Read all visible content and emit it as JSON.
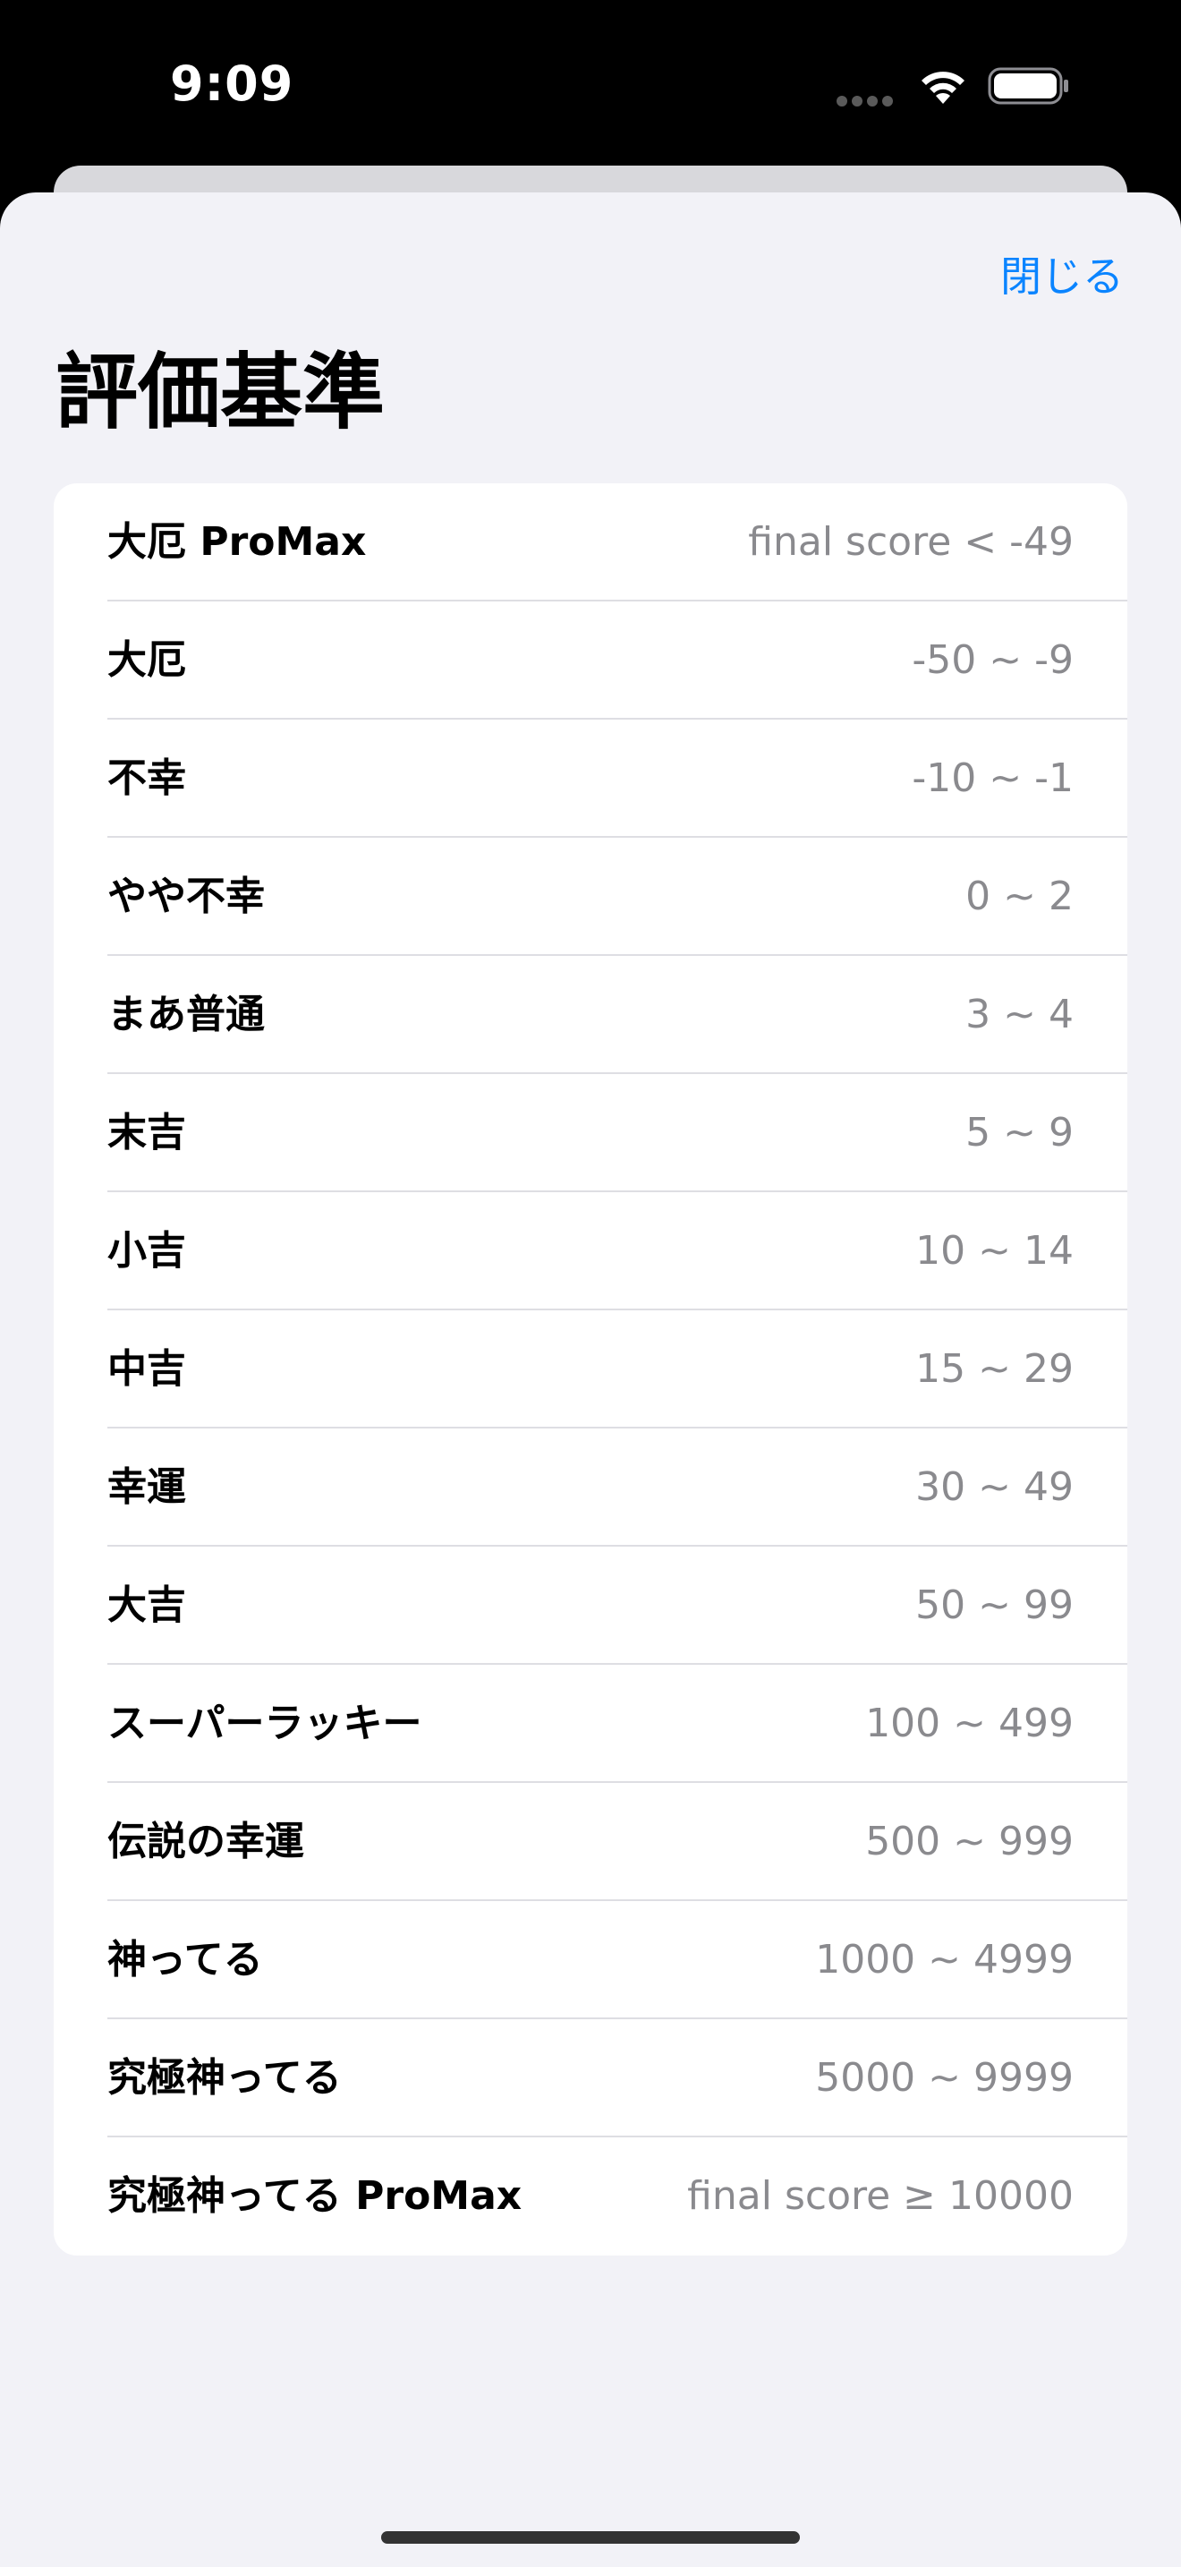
{
  "status_bar": {
    "time": "9:09",
    "wifi_icon": "wifi-icon",
    "battery_icon": "battery-icon",
    "signal_icon": "cellular-dots-icon"
  },
  "header": {
    "close_label": "閉じる",
    "title": "評価基準"
  },
  "colors": {
    "accent": "#0a84ff",
    "sheet_background": "#f2f2f7",
    "range_text": "#8a8a8e"
  },
  "criteria": [
    {
      "label": "大厄 ProMax",
      "range": "final score < -49"
    },
    {
      "label": "大厄",
      "range": "-50 ~ -9"
    },
    {
      "label": "不幸",
      "range": "-10 ~ -1"
    },
    {
      "label": "やや不幸",
      "range": "0 ~ 2"
    },
    {
      "label": "まあ普通",
      "range": "3 ~ 4"
    },
    {
      "label": "末吉",
      "range": "5 ~ 9"
    },
    {
      "label": "小吉",
      "range": "10 ~ 14"
    },
    {
      "label": "中吉",
      "range": "15 ~ 29"
    },
    {
      "label": "幸運",
      "range": "30 ~ 49"
    },
    {
      "label": "大吉",
      "range": "50 ~ 99"
    },
    {
      "label": "スーパーラッキー",
      "range": "100 ~ 499"
    },
    {
      "label": "伝説の幸運",
      "range": "500 ~ 999"
    },
    {
      "label": "神ってる",
      "range": "1000 ~ 4999"
    },
    {
      "label": "究極神ってる",
      "range": "5000 ~ 9999"
    },
    {
      "label": "究極神ってる ProMax",
      "range": "final score ≥ 10000"
    }
  ]
}
